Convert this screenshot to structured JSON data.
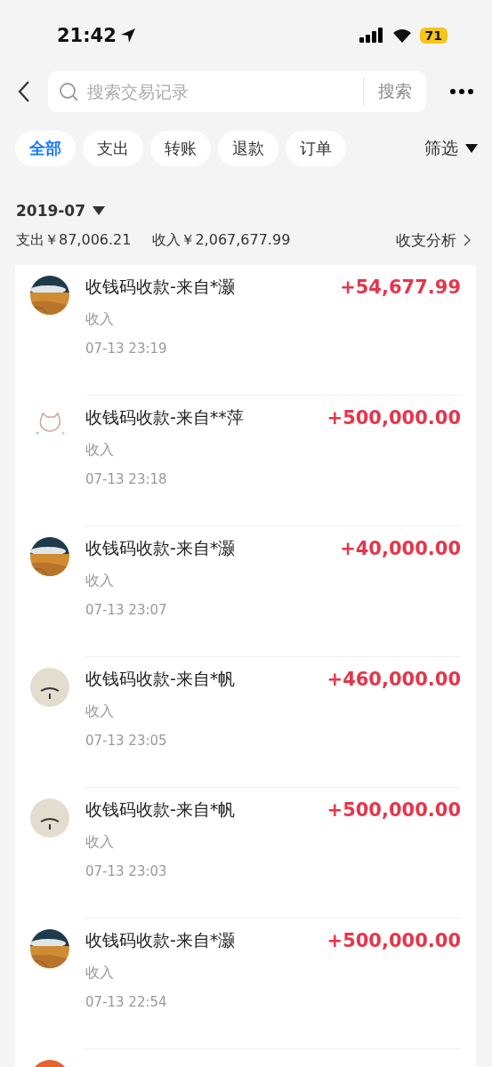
{
  "status_bar": {
    "time": "21:42",
    "battery": "71"
  },
  "search": {
    "placeholder": "搜索交易记录",
    "button": "搜索"
  },
  "tabs": [
    {
      "label": "全部",
      "selected": true
    },
    {
      "label": "支出",
      "selected": false
    },
    {
      "label": "转账",
      "selected": false
    },
    {
      "label": "退款",
      "selected": false
    },
    {
      "label": "订单",
      "selected": false
    }
  ],
  "filter": "筛选",
  "month": "2019-07",
  "summary": {
    "expense": "支出￥87,006.21",
    "income": "收入￥2,067,677.99",
    "analysis": "收支分析"
  },
  "transactions": [
    {
      "title": "收钱码收款-来自*灏",
      "type": "收入",
      "time": "07-13 23:19",
      "amount": "+54,677.99"
    },
    {
      "kind": "sticker",
      "title": "收钱码收款-来自**萍",
      "type": "收入",
      "time": "07-13 23:18",
      "amount": "+500,000.00"
    },
    {
      "title": "收钱码收款-来自*灏",
      "type": "收入",
      "time": "07-13 23:07",
      "amount": "+40,000.00"
    },
    {
      "kind": "mask",
      "title": "收钱码收款-来自*帆",
      "type": "收入",
      "time": "07-13 23:05",
      "amount": "+460,000.00"
    },
    {
      "kind": "mask",
      "title": "收钱码收款-来自*帆",
      "type": "收入",
      "time": "07-13 23:03",
      "amount": "+500,000.00"
    },
    {
      "title": "收钱码收款-来自*灏",
      "type": "收入",
      "time": "07-13 22:54",
      "amount": "+500,000.00"
    },
    {
      "kind": "orange"
    }
  ]
}
